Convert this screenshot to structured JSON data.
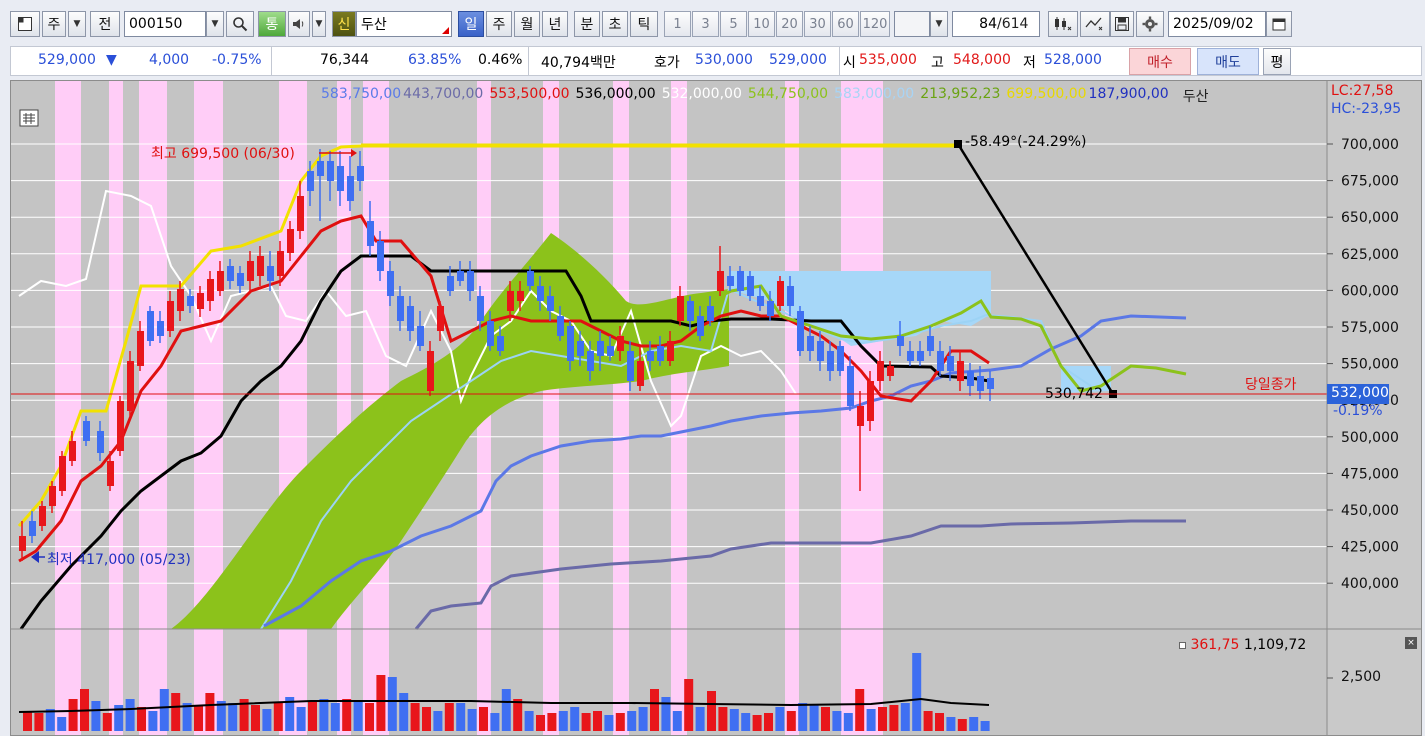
{
  "toolbar": {
    "market_label": "주",
    "prev_label": "전",
    "code": "000150",
    "tong_label": "통",
    "shin_label": "신",
    "stock_name": "두산",
    "periods": [
      "일",
      "주",
      "월",
      "년",
      "분",
      "초",
      "틱"
    ],
    "selected_period": "일",
    "intervals": [
      "1",
      "3",
      "5",
      "10",
      "20",
      "30",
      "60",
      "120"
    ],
    "bar_count": "84",
    "bar_total": "/614",
    "date": "2025/09/02"
  },
  "quote": {
    "price": "529,000",
    "change_arrow": "▼",
    "change": "4,000",
    "change_pct": "-0.75%",
    "volume": "76,344",
    "vol_ratio": "63.85%",
    "turnover": "0.46%",
    "amount": "40,794백만",
    "hoga_label": "호가",
    "ask": "530,000",
    "bid": "529,000",
    "open_label": "시",
    "open": "535,000",
    "high_label": "고",
    "high": "548,000",
    "low_label": "저",
    "low": "528,000",
    "buy_label": "매수",
    "sell_label": "매도",
    "eval_label": "평"
  },
  "chart": {
    "legend": [
      {
        "text": "583,750,00",
        "color": "#5b7be8"
      },
      {
        "text": "443,700,00",
        "color": "#6b6ba8"
      },
      {
        "text": "553,500,00",
        "color": "#e01010"
      },
      {
        "text": "536,000,00",
        "color": "#000000"
      },
      {
        "text": "532,000,00",
        "color": "#ffffff"
      },
      {
        "text": "544,750,00",
        "color": "#8cc21b"
      },
      {
        "text": "583,000,00",
        "color": "#a8d4f5"
      },
      {
        "text": "213,952,23",
        "color": "#6aa312"
      },
      {
        "text": "699,500,00",
        "color": "#e8d800"
      },
      {
        "text": "187,900,00",
        "color": "#2030c0"
      }
    ],
    "legend_name": "두산",
    "lc": "LC:27,58",
    "hc": "HC:-23,95",
    "y_labels": [
      "700,000",
      "675,000",
      "650,000",
      "625,000",
      "600,000",
      "575,000",
      "550,000",
      "525,000",
      "500,000",
      "475,000",
      "450,000",
      "425,000",
      "400,000"
    ],
    "high_marker": "최고 699,500 (06/30)",
    "low_marker": "최저 417,000 (05/23)",
    "trend_label": "-58.49°(-24.29%)",
    "trend_end_value": "530,742",
    "close_line_label": "당일종가",
    "current_price_tag": "532,000",
    "current_change": "-0.19%",
    "vol_legend_a": "361,75",
    "vol_legend_b": "1,109,72",
    "vol_y_label": "2,500",
    "colors": {
      "up": "#e8161b",
      "down": "#3f6ff2",
      "grid": "#ffffff",
      "pink": "#ffcdf7"
    }
  },
  "chart_data": {
    "type": "candlestick",
    "y_range": [
      380000,
      710000
    ],
    "high": 699500,
    "low": 417000,
    "current": 532000,
    "volume_label_scale": [
      2500
    ]
  }
}
